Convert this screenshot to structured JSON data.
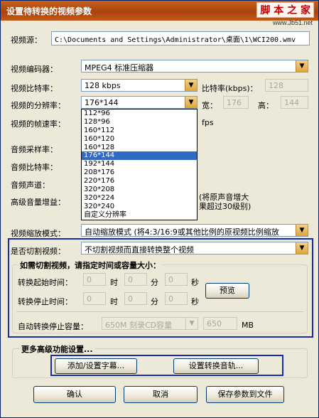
{
  "window": {
    "title": "设置待转换的视频参数",
    "watermark": "脚 本 之 家",
    "watermark_url": "www.Jb51.net"
  },
  "source": {
    "label": "视频源：",
    "value": "C:\\Documents and Settings\\Administrator\\桌面\\1\\WCI200.wmv"
  },
  "video": {
    "encoder_label": "视频编码器：",
    "encoder_value": "MPEG4 标准压缩器",
    "bitrate_label": "视频比特率：",
    "bitrate_value": "128 kbps",
    "bitrate_k_label": "比特率(kbps)：",
    "bitrate_k_value": "128",
    "resolution_label": "视频的分辨率：",
    "resolution_value": "176*144",
    "width_label": "宽：",
    "width_value": "176",
    "height_label": "高：",
    "height_value": "144",
    "framerate_label": "视频的帧速率：",
    "fps_label": "fps",
    "resolution_options": [
      "112*96",
      "128*96",
      "160*112",
      "160*120",
      "160*128",
      "176*144",
      "192*144",
      "208*176",
      "220*176",
      "320*208",
      "320*224",
      "320*240",
      "自定义分辨率"
    ],
    "resolution_selected_index": 5
  },
  "audio": {
    "samplerate_label": "音频采样率：",
    "bitrate_label": "音频比特率：",
    "channel_label": "音频声道：",
    "gain_label": "高级音量增益：",
    "gain_note_1": "(将原声音增大",
    "gain_note_2": "果超过30级别)"
  },
  "scale": {
    "label": "视频缩放模式：",
    "value": "自动缩放模式 (将4:3/16:9或其他比例的原视频比例缩放"
  },
  "cut": {
    "label": "是否切割视频：",
    "value": "不切割视频而直接转换整个视频",
    "group_title": "如需切割视频，请指定时间或容量大小：",
    "start_label": "转换起始时间：",
    "stop_label": "转换停止时间：",
    "h_unit": "时",
    "m_unit": "分",
    "s_unit": "秒",
    "time_value": "0",
    "preview_label": "预览",
    "capacity_label": "自动转换停止容量：",
    "capacity_value": "650M 刻录CD容量",
    "capacity_num": "650",
    "mb_label": "MB"
  },
  "advanced": {
    "group_title": "更多高级功能设置...",
    "subtitle_label": "添加/设置字幕...",
    "audio_track_label": "设置转换音轨..."
  },
  "buttons": {
    "ok_label": "确认",
    "cancel_label": "取消",
    "save_label": "保存参数到文件"
  }
}
